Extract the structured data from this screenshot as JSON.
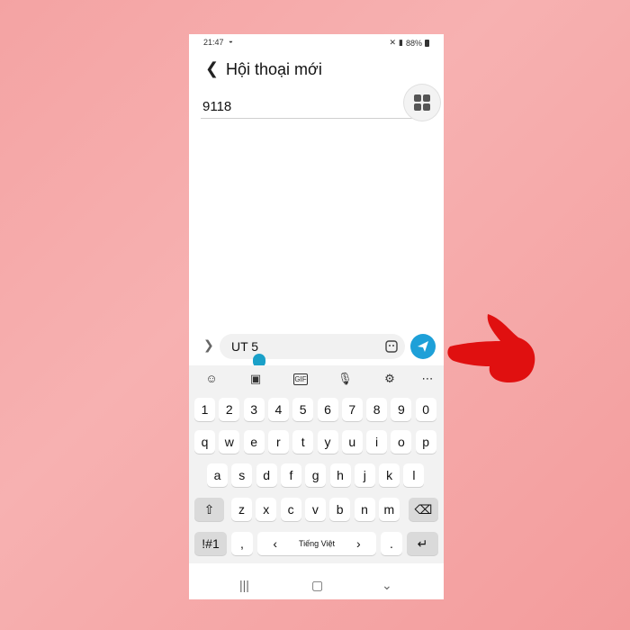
{
  "status_bar": {
    "time": "21:47",
    "wifi_icon": "wifi-icon",
    "signal_text": "88%"
  },
  "header": {
    "title": "Hội thoại mới",
    "back_icon": "back-arrow-icon"
  },
  "recipient": {
    "value": "9118",
    "placeholder": ""
  },
  "composer": {
    "value": "UT 5",
    "placeholder": ""
  },
  "keyboard": {
    "tools": [
      "emoji",
      "sticker",
      "GIF",
      "mic",
      "settings",
      "more"
    ],
    "gif_label": "GIF",
    "row1": [
      "1",
      "2",
      "3",
      "4",
      "5",
      "6",
      "7",
      "8",
      "9",
      "0"
    ],
    "row2": [
      "q",
      "w",
      "e",
      "r",
      "t",
      "y",
      "u",
      "i",
      "o",
      "p"
    ],
    "row3": [
      "a",
      "s",
      "d",
      "f",
      "g",
      "h",
      "j",
      "k",
      "l"
    ],
    "row4": [
      "z",
      "x",
      "c",
      "v",
      "b",
      "n",
      "m"
    ],
    "symbols_label": "!#1",
    "comma_label": ",",
    "period_label": ".",
    "language_label": "Tiếng Việt",
    "lang_left": "‹",
    "lang_right": "›"
  },
  "colors": {
    "send": "#1ea0d8",
    "background": "#f4a3a3",
    "hand": "#e01010"
  }
}
